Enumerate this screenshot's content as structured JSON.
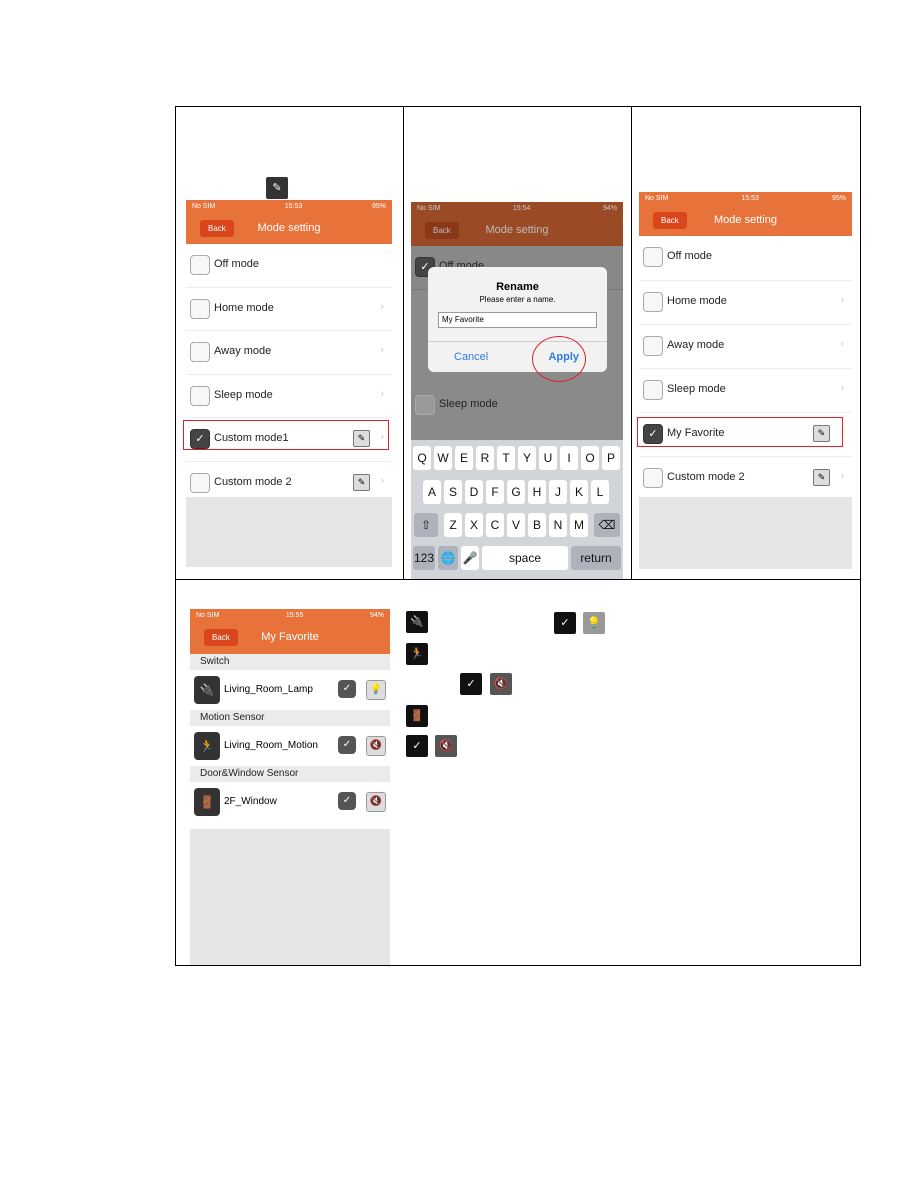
{
  "screen1": {
    "status": {
      "carrier": "No SIM",
      "time": "15:53",
      "battery": "95%"
    },
    "back": "Back",
    "title": "Mode setting",
    "modes": [
      "Off mode",
      "Home mode",
      "Away mode",
      "Sleep mode",
      "Custom mode1",
      "Custom mode 2"
    ]
  },
  "screen2": {
    "status": {
      "carrier": "No SIM",
      "time": "15:54",
      "battery": "94%"
    },
    "back": "Back",
    "title": "Mode setting",
    "visible_rows": [
      "Off mode",
      "Sleep mode"
    ],
    "dialog": {
      "title": "Rename",
      "message": "Please enter a name.",
      "input_value": "My Favorite",
      "cancel": "Cancel",
      "apply": "Apply"
    },
    "keyboard": {
      "row1": [
        "Q",
        "W",
        "E",
        "R",
        "T",
        "Y",
        "U",
        "I",
        "O",
        "P"
      ],
      "row2": [
        "A",
        "S",
        "D",
        "F",
        "G",
        "H",
        "J",
        "K",
        "L"
      ],
      "row3": [
        "Z",
        "X",
        "C",
        "V",
        "B",
        "N",
        "M"
      ],
      "numbers": "123",
      "space": "space",
      "return": "return"
    }
  },
  "screen3": {
    "status": {
      "carrier": "No SIM",
      "time": "15:53",
      "battery": "95%"
    },
    "back": "Back",
    "title": "Mode setting",
    "modes": [
      "Off mode",
      "Home mode",
      "Away mode",
      "Sleep mode",
      "My Favorite",
      "Custom mode 2"
    ]
  },
  "screen4": {
    "status": {
      "carrier": "No SIM",
      "time": "15:55",
      "battery": "94%"
    },
    "back": "Back",
    "title": "My Favorite",
    "sections": [
      {
        "name": "Switch",
        "device": "Living_Room_Lamp",
        "action_icon": "bulb-icon"
      },
      {
        "name": "Motion Sensor",
        "device": "Living_Room_Motion",
        "action_icon": "mute-icon"
      },
      {
        "name": "Door&Window Sensor",
        "device": "2F_Window",
        "action_icon": "mute-icon"
      }
    ]
  },
  "colors": {
    "header": "#e8733a",
    "highlight": "#e0202a"
  }
}
